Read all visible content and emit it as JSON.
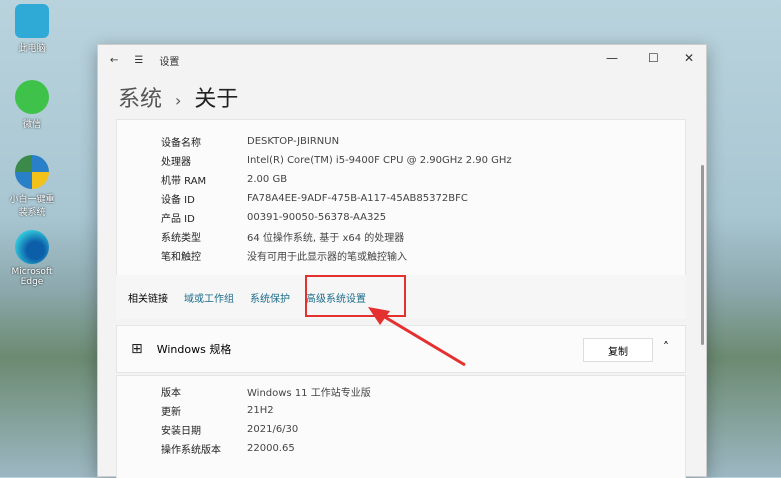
{
  "desktop": [
    "此电脑",
    "微信",
    "小白一键重装系统",
    "Microsoft Edge"
  ],
  "titlebar": {
    "back": "←",
    "menu": "☰",
    "title": "设置",
    "min": "—",
    "max": "☐",
    "close": "✕"
  },
  "breadcrumb": {
    "parent": "系统",
    "sep": "›",
    "current": "关于"
  },
  "device_specs": [
    {
      "k": "设备名称",
      "v": "DESKTOP-JBIRNUN"
    },
    {
      "k": "处理器",
      "v": "Intel(R) Core(TM) i5-9400F CPU @ 2.90GHz   2.90 GHz"
    },
    {
      "k": "机带 RAM",
      "v": "2.00 GB"
    },
    {
      "k": "设备 ID",
      "v": "FA78A4EE-9ADF-475B-A117-45AB85372BFC"
    },
    {
      "k": "产品 ID",
      "v": "00391-90050-56378-AA325"
    },
    {
      "k": "系统类型",
      "v": "64 位操作系统, 基于 x64 的处理器"
    },
    {
      "k": "笔和触控",
      "v": "没有可用于此显示器的笔或触控输入"
    }
  ],
  "related": {
    "label": "相关链接",
    "links": [
      "域或工作组",
      "系统保护",
      "高级系统设置"
    ]
  },
  "windows": {
    "title": "Windows 规格",
    "copy": "复制",
    "chevron": "˄",
    "specs": [
      {
        "k": "版本",
        "v": "Windows 11 工作站专业版"
      },
      {
        "k": "更新",
        "v": "21H2"
      },
      {
        "k": "安装日期",
        "v": "2021/6/30"
      },
      {
        "k": "操作系统版本",
        "v": "22000.65"
      }
    ]
  }
}
